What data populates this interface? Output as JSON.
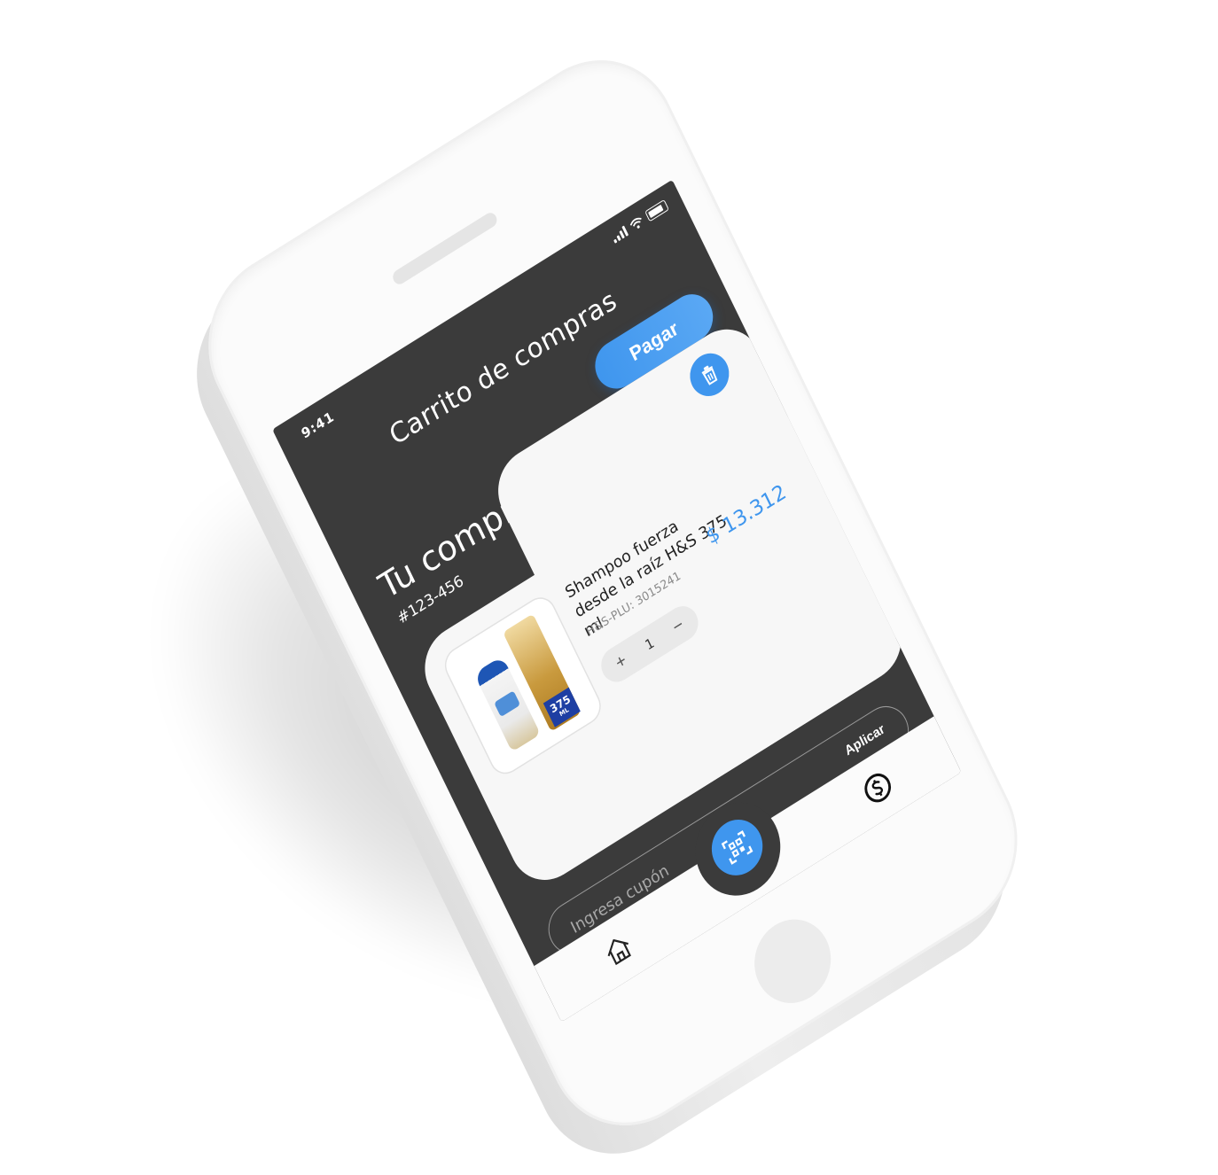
{
  "status_bar": {
    "time": "9:41"
  },
  "header": {
    "title": "Carrito de compras",
    "pay_label": "Pagar"
  },
  "purchase": {
    "heading": "Tu compra",
    "id": "#123-456"
  },
  "cart": {
    "items": [
      {
        "name": "Shampoo fuerza desde la raíz H&S 375 ml",
        "sku": "H&S-PLU: 3015241",
        "price": "$ 13.312",
        "quantity": "1",
        "thumb_badge": "375",
        "thumb_badge_unit": "ML"
      }
    ]
  },
  "coupon": {
    "placeholder": "Ingresa cupón",
    "apply_label": "Aplicar"
  },
  "tab_bar": {
    "items": [
      {
        "icon": "home-icon"
      },
      {
        "icon": "scan-icon"
      },
      {
        "icon": "dollar-circle-icon"
      }
    ]
  },
  "colors": {
    "accent": "#3f96ee",
    "screen_bg": "#3b3b3b",
    "card_bg": "#f7f7f7",
    "phone_body": "#fbfbfb"
  }
}
